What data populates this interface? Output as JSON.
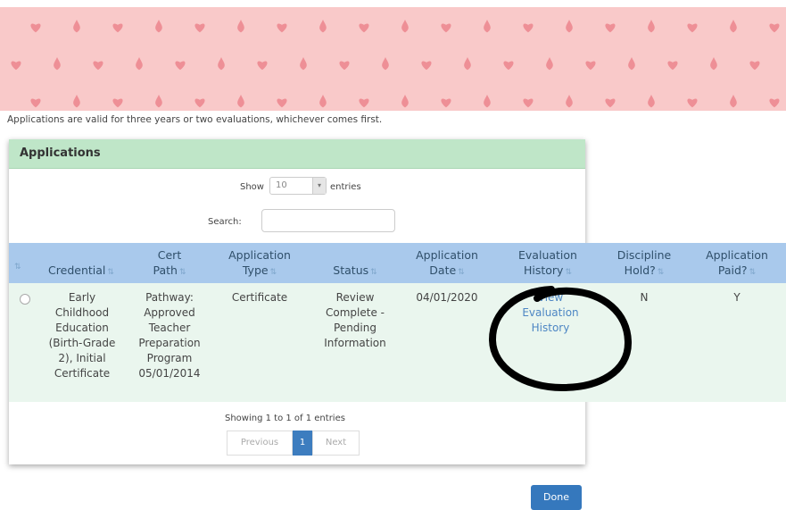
{
  "notice": "Applications are valid for three years or two evaluations, whichever comes first.",
  "panel": {
    "title": "Applications"
  },
  "length_control": {
    "show_label": "Show",
    "value": "10",
    "suffix": "entries"
  },
  "search": {
    "label": "Search:",
    "value": ""
  },
  "table": {
    "headers": {
      "credential": "Credential",
      "cert_path": "Cert\nPath",
      "application_type": "Application\nType",
      "status": "Status",
      "application_date": "Application\nDate",
      "evaluation_history": "Evaluation\nHistory",
      "discipline_hold": "Discipline\nHold?",
      "application_paid": "Application\nPaid?"
    },
    "rows": [
      {
        "credential": "Early\nChildhood\nEducation\n(Birth-Grade\n2), Initial\nCertificate",
        "cert_path": "Pathway:\nApproved\nTeacher\nPreparation\nProgram\n05/01/2014",
        "application_type": "Certificate",
        "status": "Review\nComplete -\nPending\nInformation",
        "application_date": "04/01/2020",
        "evaluation_history": "View\nEvaluation\nHistory",
        "discipline_hold": "N",
        "application_paid": "Y"
      }
    ]
  },
  "info": "Showing 1 to 1 of 1 entries",
  "pager": {
    "previous": "Previous",
    "current": "1",
    "next": "Next"
  },
  "done_label": "Done",
  "colors": {
    "banner": "#f9c9c9",
    "heart": "#ee8f96",
    "panel_header": "#bfe6c8",
    "table_header": "#a9c9ec",
    "row": "#eaf6ee",
    "primary": "#3578bd",
    "link": "#4d86c4"
  }
}
